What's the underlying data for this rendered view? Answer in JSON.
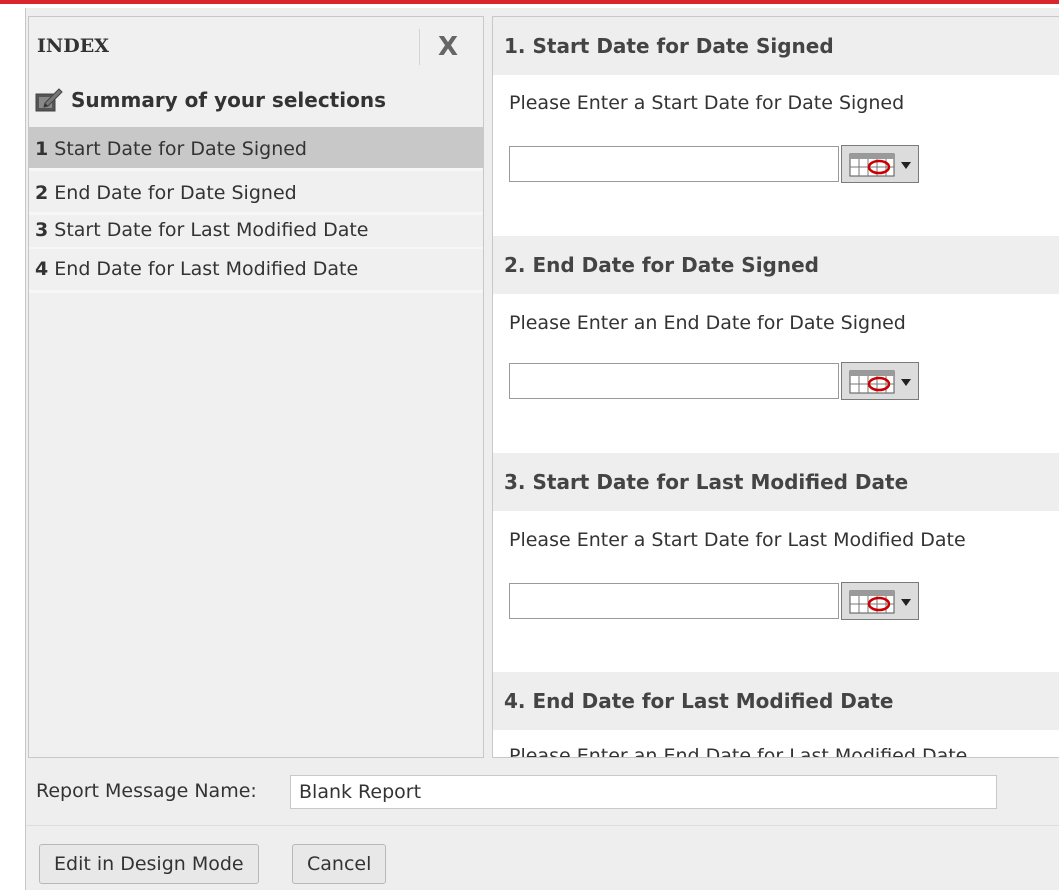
{
  "index": {
    "title": "INDEX",
    "close_glyph": "X",
    "summary_label": "Summary of your selections",
    "items": [
      {
        "num": "1",
        "label": "Start Date for Date Signed"
      },
      {
        "num": "2",
        "label": "End Date for Date Signed"
      },
      {
        "num": "3",
        "label": "Start Date for Last Modified Date"
      },
      {
        "num": "4",
        "label": "End Date for Last Modified Date"
      }
    ]
  },
  "sections": [
    {
      "heading": "1.  Start Date for Date Signed",
      "prompt": "Please Enter a Start Date for Date Signed",
      "value": ""
    },
    {
      "heading": "2.  End Date for Date Signed",
      "prompt": "Please Enter an End Date for Date Signed",
      "value": ""
    },
    {
      "heading": "3.  Start Date for Last Modified Date",
      "prompt": "Please Enter a Start Date for Last Modified Date",
      "value": ""
    },
    {
      "heading": "4.  End Date for Last Modified Date",
      "prompt": "Please Enter an End Date for Last Modified Date",
      "value": ""
    }
  ],
  "footer": {
    "report_name_label": "Report Message Name:",
    "report_name_value": "Blank Report",
    "edit_button": "Edit in Design Mode",
    "cancel_button": "Cancel"
  },
  "colors": {
    "accent_line": "#d9262c",
    "selected_item": "#c8c8c8",
    "calendar_ring": "#cc0000"
  }
}
